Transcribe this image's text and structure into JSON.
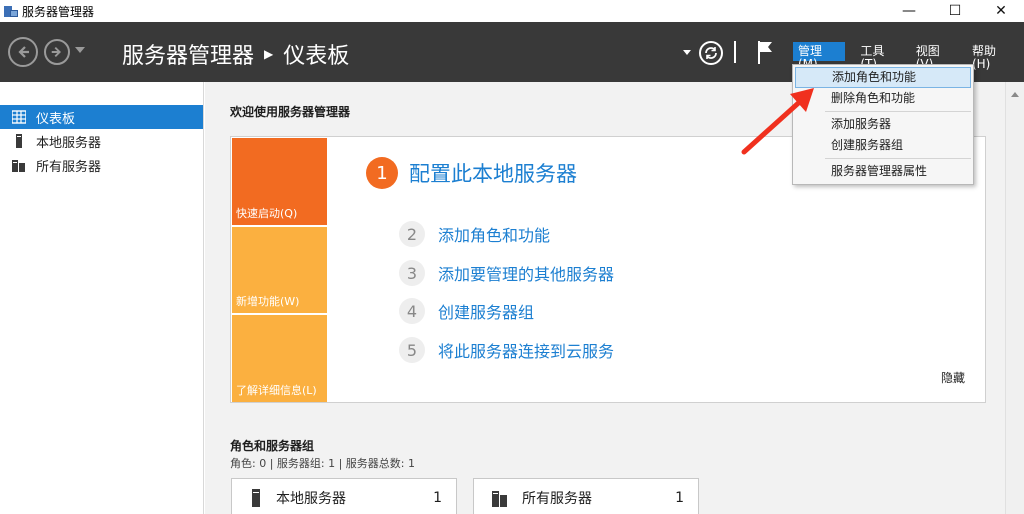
{
  "window": {
    "title": "服务器管理器",
    "minimize": "—",
    "maximize": "☐",
    "close": "✕"
  },
  "header": {
    "breadcrumb_root": "服务器管理器",
    "breadcrumb_sep": "▶",
    "breadcrumb_current": "仪表板",
    "menus": [
      {
        "label": "管理(M)",
        "active": true
      },
      {
        "label": "工具(T)"
      },
      {
        "label": "视图(V)"
      },
      {
        "label": "帮助(H)"
      }
    ]
  },
  "dropdown": {
    "items": [
      {
        "label": "添加角色和功能",
        "highlighted": true
      },
      {
        "label": "删除角色和功能"
      },
      {
        "label": "添加服务器"
      },
      {
        "label": "创建服务器组"
      },
      {
        "label": "服务器管理器属性"
      }
    ]
  },
  "sidebar": {
    "items": [
      {
        "label": "仪表板",
        "icon": "dashboard-icon",
        "active": true
      },
      {
        "label": "本地服务器",
        "icon": "server-icon"
      },
      {
        "label": "所有服务器",
        "icon": "servers-icon"
      }
    ]
  },
  "main": {
    "welcome": "欢迎使用服务器管理器",
    "tiles": [
      {
        "label": "快速启动(Q)"
      },
      {
        "label": "新增功能(W)"
      },
      {
        "label": "了解详细信息(L)"
      }
    ],
    "steps": [
      {
        "num": "1",
        "label": "配置此本地服务器"
      },
      {
        "num": "2",
        "label": "添加角色和功能"
      },
      {
        "num": "3",
        "label": "添加要管理的其他服务器"
      },
      {
        "num": "4",
        "label": "创建服务器组"
      },
      {
        "num": "5",
        "label": "将此服务器连接到云服务"
      }
    ],
    "hide": "隐藏",
    "roles_title": "角色和服务器组",
    "roles_subtitle": "角色: 0 | 服务器组: 1 | 服务器总数: 1",
    "cards": [
      {
        "label": "本地服务器",
        "count": "1"
      },
      {
        "label": "所有服务器",
        "count": "1"
      }
    ]
  },
  "colors": {
    "header_bg": "#393939",
    "accent": "#1c7fd1",
    "tile_orange": "#f26b21",
    "tile_yellow": "#fbb040",
    "arrow_red": "#f0301e"
  }
}
